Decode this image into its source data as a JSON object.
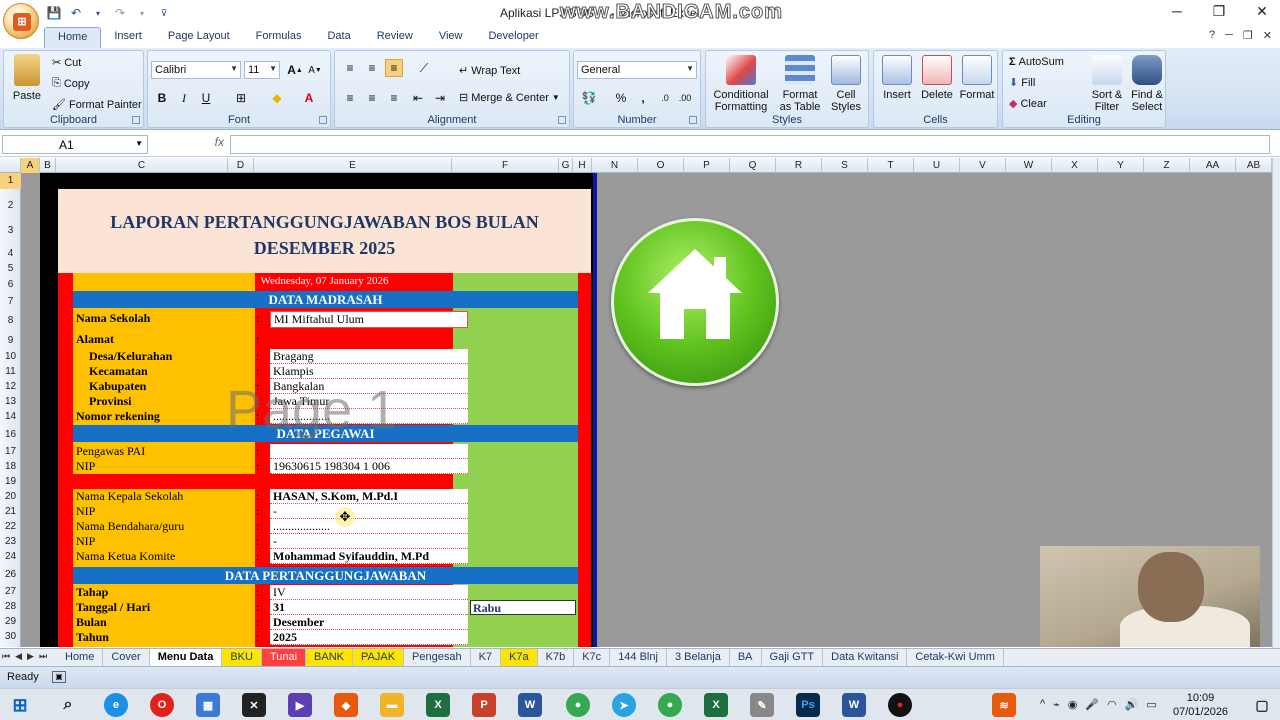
{
  "window": {
    "title": "Aplikasi LPJ BOS ... - Microsoft Excel",
    "watermark": "www.BANDICAM.com",
    "minimize": "─",
    "restore": "❐",
    "close": "✕"
  },
  "ribbon_tabs": [
    "Home",
    "Insert",
    "Page Layout",
    "Formulas",
    "Data",
    "Review",
    "View",
    "Developer"
  ],
  "clipboard": {
    "paste": "Paste",
    "cut": "Cut",
    "copy": "Copy",
    "format_painter": "Format Painter",
    "label": "Clipboard"
  },
  "font": {
    "name": "Calibri",
    "size": "11",
    "bold": "B",
    "italic": "I",
    "underline": "U",
    "label": "Font"
  },
  "alignment": {
    "wrap": "Wrap Text",
    "merge": "Merge & Center",
    "label": "Alignment"
  },
  "number": {
    "format": "General",
    "percent": "%",
    "comma": ",",
    "label": "Number"
  },
  "styles": {
    "conditional": "Conditional Formatting",
    "as_table": "Format as Table",
    "cell_styles": "Cell Styles",
    "label": "Styles"
  },
  "cells": {
    "insert": "Insert",
    "delete": "Delete",
    "format": "Format",
    "label": "Cells"
  },
  "editing": {
    "autosum": "AutoSum",
    "fill": "Fill",
    "clear": "Clear",
    "sort": "Sort & Filter",
    "find": "Find & Select",
    "label": "Editing"
  },
  "formula_bar": {
    "name_box": "A1",
    "fx": "fx",
    "content": ""
  },
  "columns": [
    "A",
    "B",
    "C",
    "D",
    "E",
    "F",
    "G",
    "H",
    "N",
    "O",
    "P",
    "Q",
    "R",
    "S",
    "T",
    "U",
    "V",
    "W",
    "X",
    "Y",
    "Z",
    "AA",
    "AB"
  ],
  "rows": [
    "1",
    "2",
    "3",
    "4",
    "5",
    "6",
    "7",
    "8",
    "9",
    "10",
    "11",
    "12",
    "13",
    "14",
    "16",
    "17",
    "18",
    "19",
    "20",
    "21",
    "22",
    "23",
    "24",
    "26",
    "27",
    "28",
    "29",
    "30"
  ],
  "sheet": {
    "title_line1": "LAPORAN PERTANGGUNGJAWABAN BOS BULAN",
    "title_line2": "DESEMBER 2025",
    "date": "Wednesday, 07 January 2026",
    "sec_madrasah": "DATA MADRASAH",
    "sec_pegawai": "DATA PEGAWAI",
    "sec_lpj": "DATA PERTANGGUNGJAWABAN",
    "colon": ":",
    "fields": {
      "nama_sekolah": {
        "label": "Nama Sekolah",
        "value": "MI Miftahul Ulum"
      },
      "alamat": {
        "label": "Alamat",
        "value": ""
      },
      "desa": {
        "label": "Desa/Kelurahan",
        "value": "Bragang"
      },
      "kecamatan": {
        "label": "Kecamatan",
        "value": "Klampis"
      },
      "kabupaten": {
        "label": "Kabupaten",
        "value": "Bangkalan"
      },
      "provinsi": {
        "label": "Provinsi",
        "value": "Jawa Timur"
      },
      "rekening": {
        "label": "Nomor rekening",
        "value": "..................."
      },
      "pengawas": {
        "label": "Pengawas PAI",
        "value": ""
      },
      "nip_pengawas": {
        "label": "NIP",
        "value": "19630615 198304 1 006"
      },
      "kepala": {
        "label": "Nama Kepala Sekolah",
        "value": "HASAN, S.Kom, M.Pd.I"
      },
      "nip_kepala": {
        "label": "NIP",
        "value": "-"
      },
      "bendahara": {
        "label": "Nama Bendahara/guru",
        "value": "..................."
      },
      "nip_bendahara": {
        "label": "NIP",
        "value": "-"
      },
      "komite": {
        "label": "Nama Ketua Komite",
        "value": "Mohammad Syifauddin, M.Pd"
      },
      "tahap": {
        "label": "Tahap",
        "value": "IV"
      },
      "tanggal": {
        "label": "Tanggal / Hari",
        "value": "31",
        "day": "Rabu"
      },
      "bulan": {
        "label": "Bulan",
        "value": "Desember"
      },
      "tahun": {
        "label": "Tahun",
        "value": "2025"
      }
    },
    "page_watermark": "Page 1"
  },
  "sheet_tabs": [
    "Home",
    "Cover",
    "Menu Data",
    "BKU",
    "Tunai",
    "BANK",
    "PAJAK",
    "Pengesah",
    "K7",
    "K7a",
    "K7b",
    "K7c",
    "144 Blnj",
    "3 Belanja",
    "BA",
    "Gaji GTT",
    "Data Kwitansi",
    "Cetak-Kwi Umm"
  ],
  "active_sheet": "Menu Data",
  "status": {
    "ready": "Ready"
  },
  "taskbar": {
    "time": "10:09",
    "date": "07/01/2026"
  }
}
